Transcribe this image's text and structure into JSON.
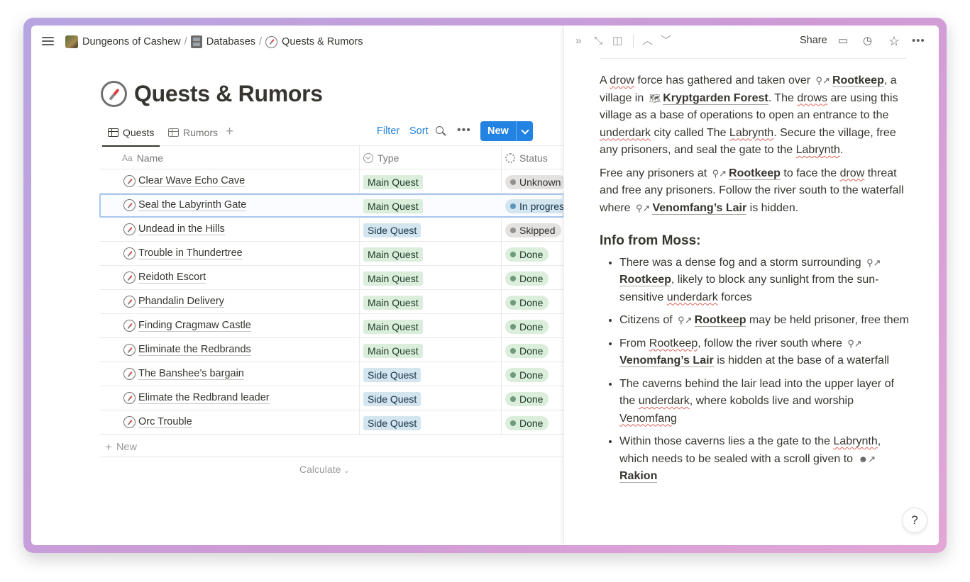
{
  "breadcrumb": [
    {
      "label": "Dungeons of Cashew",
      "icon": "cashew-avatar-icon"
    },
    {
      "label": "Databases",
      "icon": "file-cabinet-icon"
    },
    {
      "label": "Quests & Rumors",
      "icon": "compass-icon"
    }
  ],
  "breadcrumb_sep": "/",
  "page": {
    "title": "Quests & Rumors",
    "icon": "compass-icon"
  },
  "views": {
    "tabs": [
      {
        "label": "Quests",
        "active": true
      },
      {
        "label": "Rumors",
        "active": false
      }
    ],
    "filter_label": "Filter",
    "sort_label": "Sort",
    "new_label": "New"
  },
  "table": {
    "columns": [
      {
        "label": "Name",
        "icon": "Aa"
      },
      {
        "label": "Type",
        "icon": "select-icon"
      },
      {
        "label": "Status",
        "icon": "status-icon"
      }
    ],
    "rows": [
      {
        "name": "Clear Wave Echo Cave",
        "type": "Main Quest",
        "status": "Unknown"
      },
      {
        "name": "Seal the Labyrinth Gate",
        "type": "Main Quest",
        "status": "In progres"
      },
      {
        "name": "Undead in the Hills",
        "type": "Side Quest",
        "status": "Skipped"
      },
      {
        "name": "Trouble in Thundertree",
        "type": "Main Quest",
        "status": "Done"
      },
      {
        "name": "Reidoth Escort",
        "type": "Main Quest",
        "status": "Done"
      },
      {
        "name": "Phandalin Delivery",
        "type": "Main Quest",
        "status": "Done"
      },
      {
        "name": "Finding Cragmaw Castle",
        "type": "Main Quest",
        "status": "Done"
      },
      {
        "name": "Eliminate the Redbrands",
        "type": "Main Quest",
        "status": "Done"
      },
      {
        "name": "The Banshee’s bargain",
        "type": "Side Quest",
        "status": "Done"
      },
      {
        "name": "Elimate the Redbrand leader",
        "type": "Side Quest",
        "status": "Done"
      },
      {
        "name": "Orc Trouble",
        "type": "Side Quest",
        "status": "Done"
      }
    ],
    "new_row_label": "New",
    "calculate_label": "Calculate"
  },
  "peek": {
    "share_label": "Share",
    "p1": {
      "t1": "A ",
      "drow": "drow",
      "t2": " force has gathered and taken over ",
      "rootkeep": "Rootkeep",
      "t3": ", a village in ",
      "forest": "Kryptgarden Forest",
      "t4": ". The ",
      "drows": "drows",
      "t5": " are using this village as a base of operations to open an entrance to the ",
      "underdark": "underdark",
      "t6": " city called The ",
      "labrynth": "Labrynth",
      "t7": ". Secure the village, free any prisoners, and seal the gate to the ",
      "labrynth2": "Labrynth",
      "t8": "."
    },
    "p2": {
      "t1": "Free any prisoners at ",
      "rootkeep": "Rootkeep",
      "t2": " to face the ",
      "drow": "drow",
      "t3": " threat and free any prisoners. Follow the river south to the waterfall where ",
      "lair": "Venomfang’s Lair",
      "t4": " is hidden."
    },
    "heading": "Info from Moss:",
    "b1": {
      "t1": "There was a dense fog and a storm surrounding ",
      "rootkeep": "Rootkeep",
      "t2": ", likely to block any sunlight from the sun-sensitive ",
      "underdark": "underdark",
      "t3": " forces"
    },
    "b2": {
      "t1": "Citizens of ",
      "rootkeep": "Rootkeep",
      "t2": " may be held prisoner, free them"
    },
    "b3": {
      "t1": "From ",
      "rootkeep": "Rootkeep",
      "t2": ", follow the river south where ",
      "lair": "Venomfang’s Lair",
      "t3": " is hidden at the base of a waterfall"
    },
    "b4": {
      "t1": "The caverns behind the lair lead into the upper layer of the ",
      "underdark": "underdark",
      "t2": ", where kobolds live and worship ",
      "venomfang": "Venomfang"
    },
    "b5": {
      "t1": "Within those caverns lies a the gate to the ",
      "labrynth": "Labrynth",
      "t2": ", which needs to be sealed with a scroll given to ",
      "rakion": "Rakion"
    },
    "help_label": "?"
  },
  "colors": {
    "accent": "#2383e2",
    "main_quest_tag": "#dbeddb",
    "side_quest_tag": "#d3e5ef",
    "done_dot": "#6c9b7d",
    "progress_dot": "#5b97bd"
  }
}
